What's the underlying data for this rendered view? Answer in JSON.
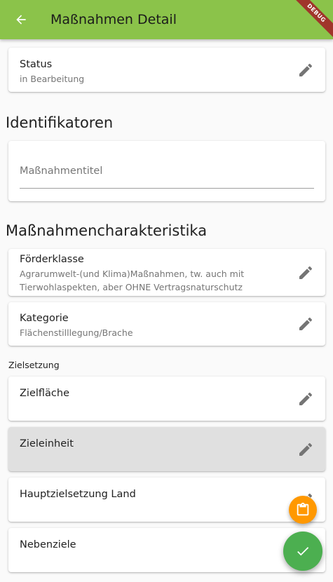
{
  "appbar": {
    "title": "Maßnahmen Detail",
    "debug_banner": "DEBUG"
  },
  "status": {
    "title": "Status",
    "value": "in Bearbeitung"
  },
  "identifikatoren": {
    "heading": "Identifikatoren",
    "field_label": "Maßnahmentitel"
  },
  "charakteristika": {
    "heading": "Maßnahmencharakteristika",
    "foerderklasse": {
      "title": "Förderklasse",
      "value": "Agrarumwelt-(und Klima)Maßnahmen, tw. auch mit Tierwohlaspekten, aber OHNE Vertragsnaturschutz"
    },
    "kategorie": {
      "title": "Kategorie",
      "value": "Flächenstilllegung/Brache"
    }
  },
  "zielsetzung": {
    "heading": "Zielsetzung",
    "items": [
      "Zielfläche",
      "Zieleinheit",
      "Hauptzielsetzung Land",
      "Nebenziele"
    ]
  },
  "colors": {
    "appbar": "#8bc34a",
    "fab": "#4caf50",
    "fab_small": "#ff9800",
    "selected_card": "#e0e0e0"
  },
  "icons": {
    "back": "arrow-back-icon",
    "edit": "pencil-icon",
    "clipboard": "clipboard-icon",
    "check": "check-icon"
  }
}
